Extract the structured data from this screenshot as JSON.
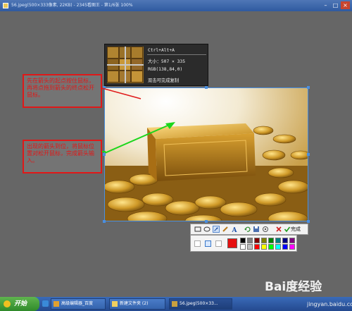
{
  "window": {
    "title": "56.jpeg(500×333像素, 22KB) - 2345看图王 - 第1/6张 100%",
    "minimize": "–",
    "maximize": "□",
    "close": "×"
  },
  "magnifier": {
    "shortcut": "Ctrl+Alt+A",
    "size": "大小：507 × 335",
    "rgb": "RGB(138,84,0)",
    "hint": "双击可完成复制"
  },
  "annotations": {
    "top": "先在箭头的起点按住鼠标，再将点拖到箭头的终点松开鼠标。",
    "bottom": "出现的箭头到位，将鼠标位置对松开鼠标，完成箭头输入。"
  },
  "toolbar": {
    "tools": [
      "rectangle-icon",
      "ellipse-icon",
      "arrow-icon",
      "brush-icon",
      "text-icon",
      "undo-icon",
      "save-icon",
      "pin-icon",
      "cancel-icon",
      "confirm-icon"
    ],
    "done_label": "完成"
  },
  "palette": {
    "sizes": [
      "small",
      "medium",
      "large"
    ],
    "current_color": "#e61010",
    "colors": [
      "#000000",
      "#808080",
      "#800000",
      "#808000",
      "#008000",
      "#008080",
      "#000080",
      "#800080",
      "#ffffff",
      "#c0c0c0",
      "#ff0000",
      "#ffff00",
      "#00ff00",
      "#00ffff",
      "#0000ff",
      "#ff00ff"
    ]
  },
  "taskbar": {
    "start_label": "开始",
    "tasks": [
      {
        "label": "高级编辑器_百度"
      },
      {
        "label": "新建文件夹 (2)"
      },
      {
        "label": "56.jpeg(500×33..."
      }
    ]
  },
  "watermark": {
    "brand": "Bai度经验",
    "url": "jingyan.baidu.com"
  },
  "colors": {
    "arrow_green": "#1cd61c",
    "annotation_red": "#e01818",
    "selection_blue": "#4a8fe0"
  }
}
